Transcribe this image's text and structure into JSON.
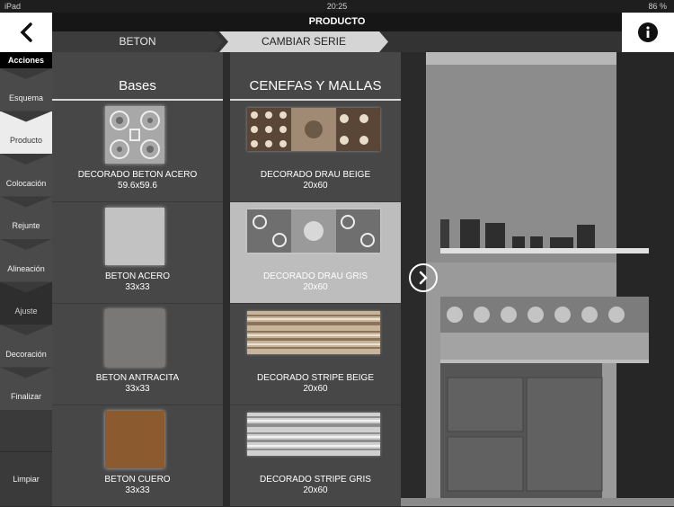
{
  "status": {
    "device": "iPad",
    "time": "20:25",
    "battery": "86 %"
  },
  "header": {
    "title": "PRODUCTO"
  },
  "breadcrumb": {
    "items": [
      "BETON",
      "CAMBIAR SERIE"
    ]
  },
  "sidebar": {
    "heading": "Acciones",
    "items": [
      "Esquema",
      "Producto",
      "Colocación",
      "Rejunte",
      "Alineación",
      "Ajuste",
      "Decoración",
      "Finalizar"
    ],
    "active": "Producto",
    "clear": "Limpiar"
  },
  "bases": {
    "title": "Bases",
    "items": [
      {
        "name": "DECORADO BETON ACERO",
        "size": "59.6x59.6",
        "swatch": "pattern-grey"
      },
      {
        "name": "BETON ACERO",
        "size": "33x33",
        "swatch": "#c2c2c2"
      },
      {
        "name": "BETON ANTRACITA",
        "size": "33x33",
        "swatch": "#7a7876"
      },
      {
        "name": "BETON CUERO",
        "size": "33x33",
        "swatch": "#8b5a2e"
      }
    ]
  },
  "cenefas": {
    "title": "CENEFAS Y MALLAS",
    "items": [
      {
        "name": "DECORADO DRAU BEIGE",
        "size": "20x60",
        "swatch": "pattern-brown"
      },
      {
        "name": "DECORADO DRAU GRIS",
        "size": "20x60",
        "swatch": "pattern-grey",
        "selected": true
      },
      {
        "name": "DECORADO STRIPE BEIGE",
        "size": "20x60",
        "swatch": "stripe-beige"
      },
      {
        "name": "DECORADO STRIPE GRIS",
        "size": "20x60",
        "swatch": "stripe-grey"
      }
    ]
  },
  "colors": {
    "accent": "#161616",
    "selected_tile": "#bdbdbd"
  }
}
